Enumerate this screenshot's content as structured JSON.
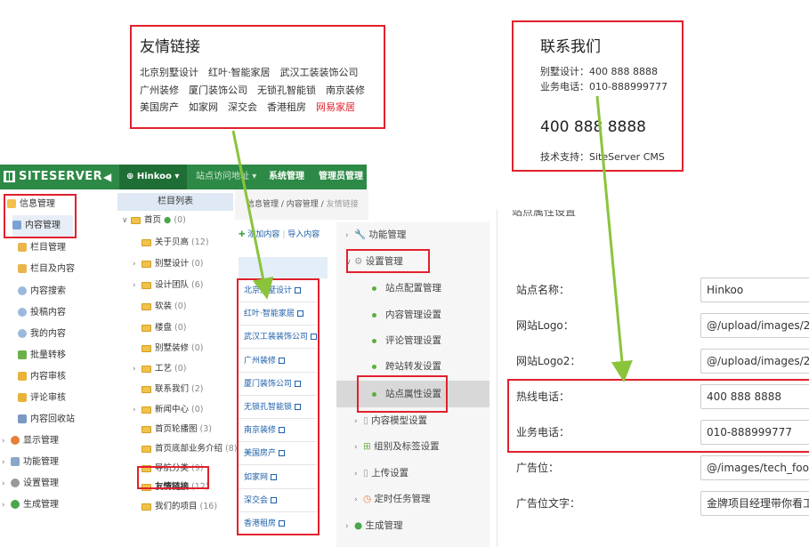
{
  "friend_links_callout": {
    "title": "友情链接",
    "row1": "北京别墅设计　红叶·智能家居　武汉工装装饰公司",
    "row2": "广州装修　厦门装饰公司　无锁孔智能锁　南京装修",
    "row3_items": [
      "美国房产",
      "如家网",
      "深交会",
      "香港租房"
    ],
    "row3_highlight": "网易家居",
    "highlight_color": "#e2202d"
  },
  "contact_callout": {
    "title": "联系我们",
    "line1": "别墅设计：400 888 8888",
    "line2": "业务电话：010-888999777",
    "hotline": "400 888 8888",
    "support": "技术支持：SiteServer CMS"
  },
  "topbar": {
    "logo_text": "SITESERVER",
    "back_icon": "arrow-left-icon",
    "site_name": "Hinkoo",
    "item1": "站点访问地址",
    "item2": "系统管理",
    "item3": "管理员管理"
  },
  "left_nav": {
    "info_mgmt": "信息管理",
    "items": [
      "内容管理",
      "栏目管理",
      "栏目及内容",
      "内容搜索",
      "投稿内容",
      "我的内容",
      "批量转移",
      "内容审核",
      "评论审核",
      "内容回收站"
    ],
    "display_mgmt": "显示管理",
    "function_mgmt": "功能管理",
    "settings_mgmt": "设置管理",
    "generate_mgmt": "生成管理"
  },
  "tree": {
    "header": "栏目列表",
    "root": {
      "label": "首页",
      "count": "(0)"
    },
    "items": [
      {
        "label": "关于贝高",
        "count": "(12)"
      },
      {
        "label": "别墅设计",
        "count": "(0)"
      },
      {
        "label": "设计团队",
        "count": "(6)"
      },
      {
        "label": "软装",
        "count": "(0)"
      },
      {
        "label": "楼盘",
        "count": "(0)"
      },
      {
        "label": "别墅装修",
        "count": "(0)"
      },
      {
        "label": "工艺",
        "count": "(0)"
      },
      {
        "label": "联系我们",
        "count": "(2)"
      },
      {
        "label": "新闻中心",
        "count": "(0)"
      },
      {
        "label": "首页轮播图",
        "count": "(3)"
      },
      {
        "label": "首页底部业务介绍",
        "count": "(8)"
      },
      {
        "label": "导航分类",
        "count": "(9)"
      },
      {
        "label": "友情链接",
        "count": "(12)"
      },
      {
        "label": "我们的项目",
        "count": "(16)"
      }
    ]
  },
  "breadcrumb": {
    "a": "信息管理",
    "b": "内容管理",
    "c": "友情链接",
    "sep": " / "
  },
  "content_toolbar": {
    "add": "添加内容",
    "import": "导入内容",
    "sep": "|"
  },
  "link_list": [
    "北京别墅设计",
    "红叶·智能家居",
    "武汉工装装饰公司",
    "广州装修",
    "厦门装饰公司",
    "无锁孔智能锁",
    "南京装修",
    "美国房产",
    "如家网",
    "深交会",
    "香港租房"
  ],
  "settings_menu": {
    "function": "功能管理",
    "settings": "设置管理",
    "sub": [
      "站点配置管理",
      "内容管理设置",
      "评论管理设置",
      "跨站转发设置",
      "站点属性设置"
    ],
    "model": "内容模型设置",
    "group": "组别及标签设置",
    "upload": "上传设置",
    "task": "定时任务管理",
    "generate": "生成管理"
  },
  "form": {
    "header": "站点属性设置",
    "fields": [
      {
        "label": "站点名称：",
        "value": "Hinkoo"
      },
      {
        "label": "网站Logo：",
        "value": "@/upload/images/2"
      },
      {
        "label": "网站Logo2：",
        "value": "@/upload/images/2"
      },
      {
        "label": "热线电话：",
        "value": "400 888 8888"
      },
      {
        "label": "业务电话：",
        "value": "010-888999777"
      },
      {
        "label": "广告位：",
        "value": "@/images/tech_foo"
      },
      {
        "label": "广告位文字：",
        "value": "金牌项目经理带你看工"
      }
    ]
  },
  "colors": {
    "brand_green": "#2d8a46",
    "callout_red": "#e2202d",
    "arrow_green": "#8ac43b",
    "link_blue": "#1d5fa9"
  }
}
